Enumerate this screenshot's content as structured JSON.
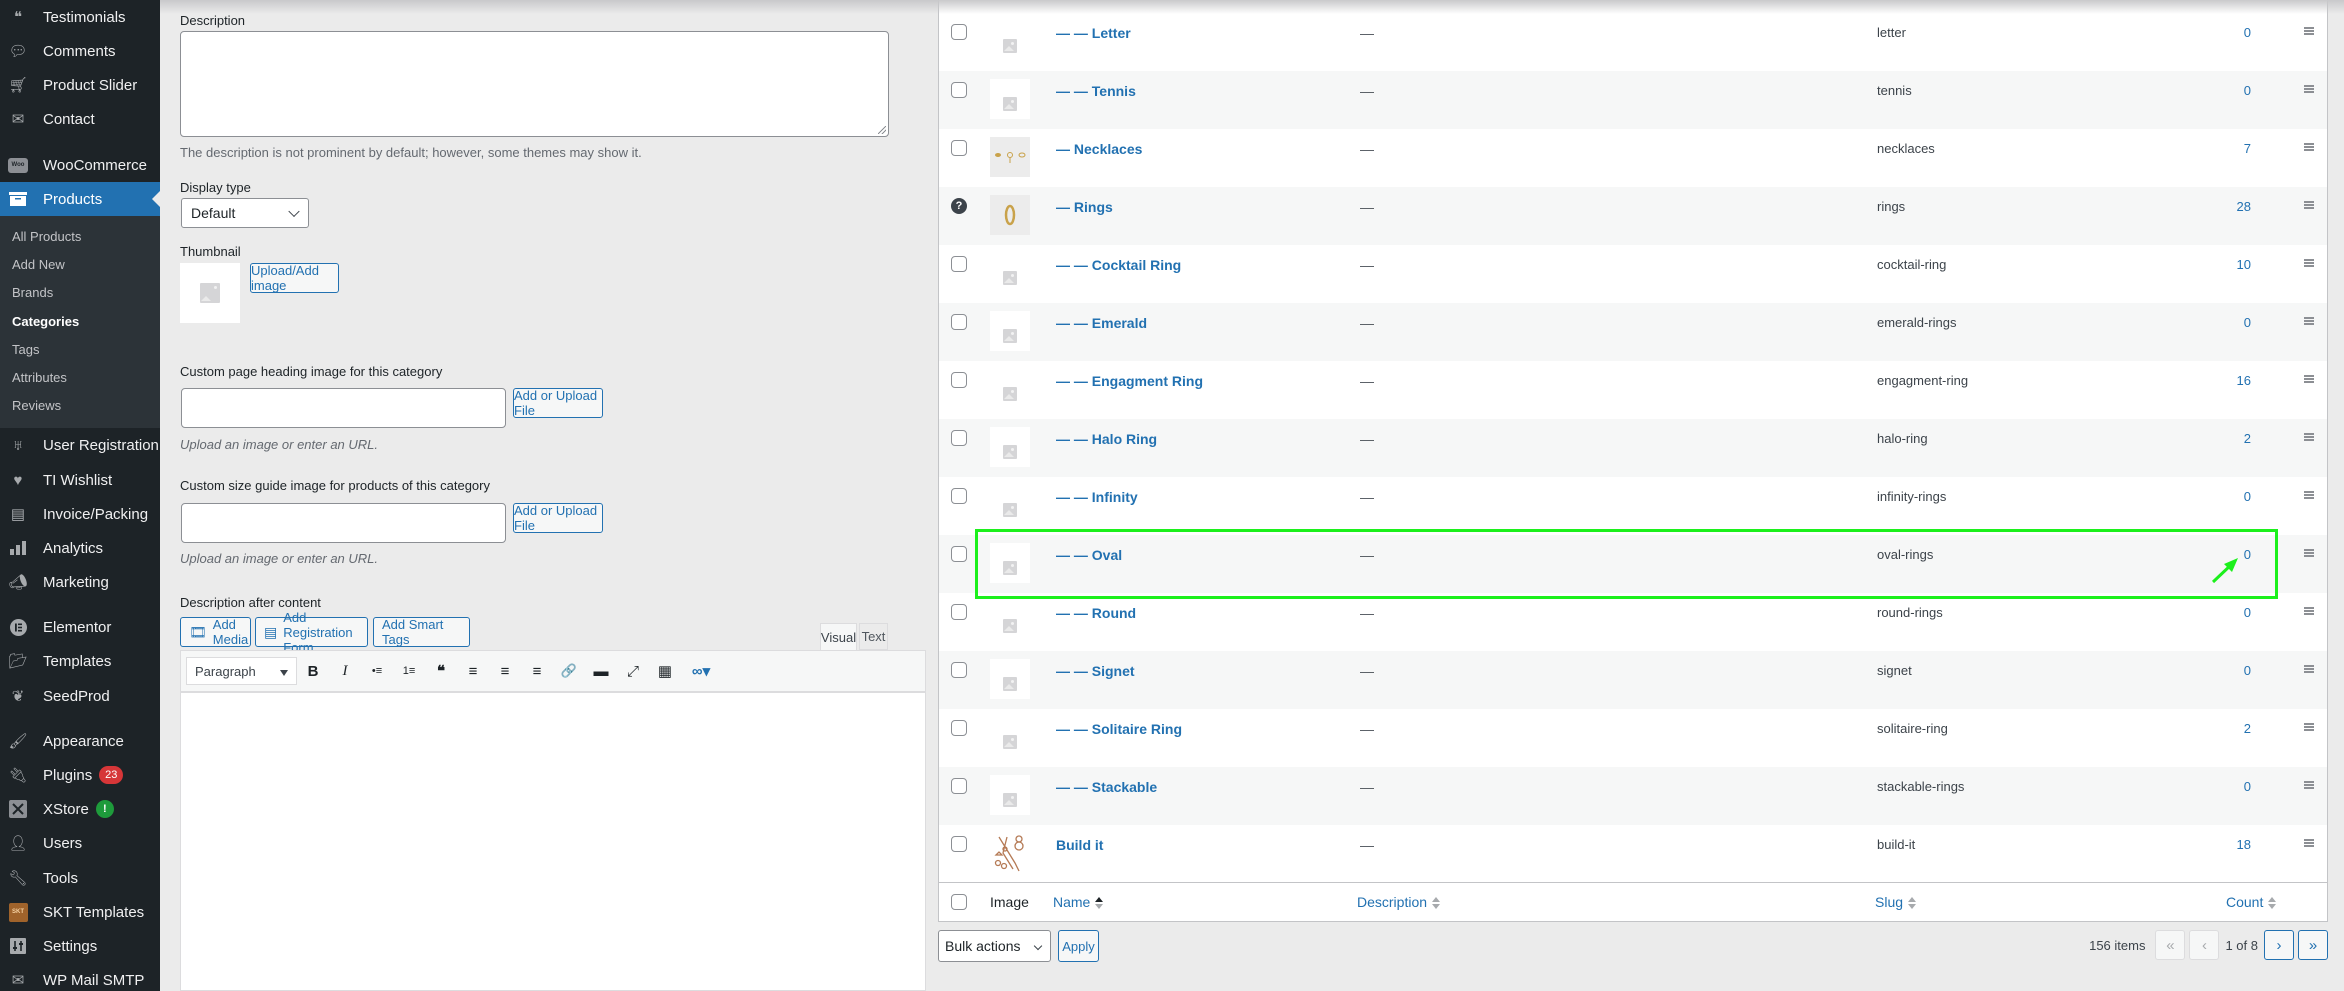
{
  "sidebar": {
    "items": [
      {
        "label": "Testimonials",
        "icon": "testimonials-icon"
      },
      {
        "label": "Comments",
        "icon": "comment-icon"
      },
      {
        "label": "Product Slider",
        "icon": "cart-icon"
      },
      {
        "label": "Contact",
        "icon": "envelope-icon"
      },
      {
        "label": "WooCommerce",
        "icon": "woo-icon"
      },
      {
        "label": "Products",
        "icon": "archive-icon",
        "active": true
      },
      {
        "label": "User Registration",
        "icon": "user-registration-icon"
      },
      {
        "label": "TI Wishlist",
        "icon": "heart-icon"
      },
      {
        "label": "Invoice/Packing",
        "icon": "document-icon"
      },
      {
        "label": "Analytics",
        "icon": "bar-chart-icon"
      },
      {
        "label": "Marketing",
        "icon": "megaphone-icon"
      },
      {
        "label": "Elementor",
        "icon": "elementor-icon"
      },
      {
        "label": "Templates",
        "icon": "folder-icon"
      },
      {
        "label": "SeedProd",
        "icon": "seedprod-icon"
      },
      {
        "label": "Appearance",
        "icon": "brush-icon"
      },
      {
        "label": "Plugins",
        "icon": "plug-icon",
        "badge": "23"
      },
      {
        "label": "XStore",
        "icon": "xstore-icon",
        "badge": "!"
      },
      {
        "label": "Users",
        "icon": "user-icon"
      },
      {
        "label": "Tools",
        "icon": "wrench-icon"
      },
      {
        "label": "SKT Templates",
        "icon": "skt-icon",
        "icon_text": "SKT"
      },
      {
        "label": "Settings",
        "icon": "settings-icon"
      },
      {
        "label": "WP Mail SMTP",
        "icon": "mail-send-icon"
      }
    ],
    "submenu": [
      {
        "label": "All Products"
      },
      {
        "label": "Add New"
      },
      {
        "label": "Brands"
      },
      {
        "label": "Categories",
        "current": true
      },
      {
        "label": "Tags"
      },
      {
        "label": "Attributes"
      },
      {
        "label": "Reviews"
      }
    ],
    "woo_icon_text": "Woo"
  },
  "form": {
    "description_label": "Description",
    "description_value": "",
    "description_help": "The description is not prominent by default; however, some themes may show it.",
    "display_type_label": "Display type",
    "display_type_value": "Default",
    "thumbnail_label": "Thumbnail",
    "upload_button": "Upload/Add image",
    "heading_image_label": "Custom page heading image for this category",
    "heading_image_value": "",
    "heading_image_button": "Add or Upload File",
    "heading_image_help": "Upload an image or enter an URL.",
    "size_guide_label": "Custom size guide image for products of this category",
    "size_guide_value": "",
    "size_guide_button": "Add or Upload File",
    "size_guide_help": "Upload an image or enter an URL.",
    "after_content_label": "Description after content",
    "add_media": "Add Media",
    "add_registration_form": "Add Registration Form",
    "add_smart_tags": "Add Smart Tags",
    "tab_visual": "Visual",
    "tab_text": "Text",
    "format_select": "Paragraph",
    "toolbar": [
      "B",
      "I",
      "•≡",
      "1≡",
      "❝",
      "≡",
      "≡",
      "≡",
      "🔗",
      "▬",
      "⤢",
      "▦",
      "∞▾"
    ]
  },
  "table": {
    "rows": [
      {
        "name": "— — Letter",
        "desc": "—",
        "slug": "letter",
        "count": "0",
        "thumb": "placeholder"
      },
      {
        "name": "— — Tennis",
        "desc": "—",
        "slug": "tennis",
        "count": "0",
        "thumb": "placeholder-boxed"
      },
      {
        "name": "— Necklaces",
        "desc": "—",
        "slug": "necklaces",
        "count": "7",
        "thumb": "photo-necklaces"
      },
      {
        "name": "— Rings",
        "desc": "—",
        "slug": "rings",
        "count": "28",
        "thumb": "photo-ring",
        "help": true
      },
      {
        "name": "— — Cocktail Ring",
        "desc": "—",
        "slug": "cocktail-ring",
        "count": "10",
        "thumb": "placeholder"
      },
      {
        "name": "— — Emerald",
        "desc": "—",
        "slug": "emerald-rings",
        "count": "0",
        "thumb": "placeholder-boxed"
      },
      {
        "name": "— — Engagment Ring",
        "desc": "—",
        "slug": "engagment-ring",
        "count": "16",
        "thumb": "placeholder"
      },
      {
        "name": "— — Halo Ring",
        "desc": "—",
        "slug": "halo-ring",
        "count": "2",
        "thumb": "placeholder-boxed"
      },
      {
        "name": "— — Infinity",
        "desc": "—",
        "slug": "infinity-rings",
        "count": "0",
        "thumb": "placeholder"
      },
      {
        "name": "— — Oval",
        "desc": "—",
        "slug": "oval-rings",
        "count": "0",
        "thumb": "placeholder-boxed",
        "highlighted": true
      },
      {
        "name": "— — Round",
        "desc": "—",
        "slug": "round-rings",
        "count": "0",
        "thumb": "placeholder"
      },
      {
        "name": "— — Signet",
        "desc": "—",
        "slug": "signet",
        "count": "0",
        "thumb": "placeholder-boxed"
      },
      {
        "name": "— — Solitaire Ring",
        "desc": "—",
        "slug": "solitaire-ring",
        "count": "2",
        "thumb": "placeholder"
      },
      {
        "name": "— — Stackable",
        "desc": "—",
        "slug": "stackable-rings",
        "count": "0",
        "thumb": "placeholder-boxed"
      },
      {
        "name": "Build it",
        "desc": "—",
        "slug": "build-it",
        "count": "18",
        "thumb": "tools-drawing"
      }
    ],
    "columns": {
      "image": "Image",
      "name": "Name",
      "description": "Description",
      "slug": "Slug",
      "count": "Count"
    },
    "bulk_actions": "Bulk actions",
    "apply": "Apply",
    "items_count": "156 items",
    "first": "«",
    "prev": "‹",
    "page_of": "1 of 8",
    "next": "›",
    "last": "»"
  },
  "annotation": {
    "color": "#1cf01c",
    "target": "oval-rings count"
  }
}
